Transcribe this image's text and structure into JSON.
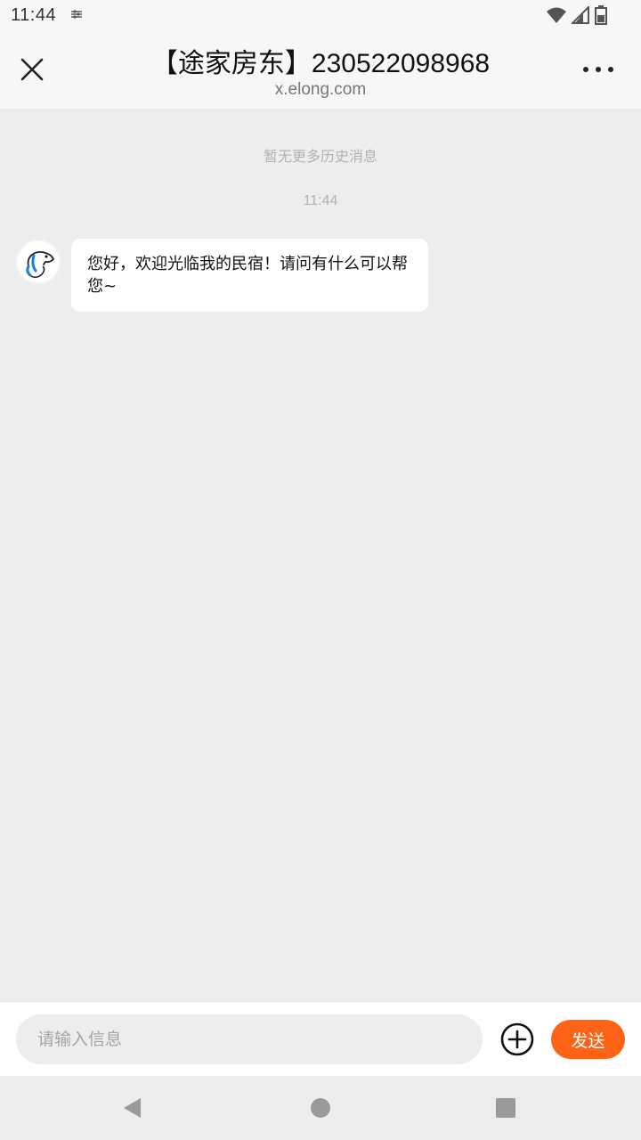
{
  "status_bar": {
    "time": "11:44",
    "icons": [
      "settings-icon",
      "wifi-icon",
      "signal-icon",
      "battery-icon"
    ]
  },
  "header": {
    "title": "【途家房东】230522098968",
    "subtitle": "x.elong.com",
    "close_icon": "close-icon",
    "more_icon": "more-icon"
  },
  "chat": {
    "no_history": "暂无更多历史消息",
    "messages": [
      {
        "time": "11:44",
        "sender": "host",
        "avatar_icon": "dog-logo-icon",
        "text": "您好，欢迎光临我的民宿！请问有什么可以帮您~"
      }
    ]
  },
  "input_bar": {
    "placeholder": "请输入信息",
    "value": "",
    "plus_icon": "plus-circle-icon",
    "send_label": "发送"
  },
  "colors": {
    "accent": "#ff6315",
    "background": "#ededed",
    "bubble": "#ffffff"
  }
}
